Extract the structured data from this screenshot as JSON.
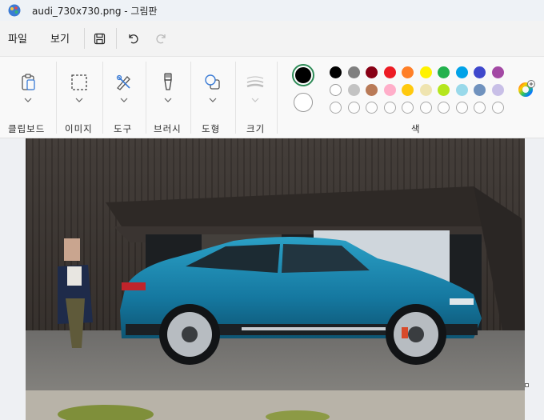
{
  "window": {
    "title": "audi_730x730.png - 그림판"
  },
  "menu": {
    "file": "파일",
    "view": "보기"
  },
  "toolbar": {
    "save_icon": "save-icon",
    "undo_icon": "undo-icon",
    "redo_icon": "redo-icon"
  },
  "ribbon": {
    "groups": [
      {
        "label": "클립보드",
        "icon": "clipboard-icon"
      },
      {
        "label": "이미지",
        "icon": "select-icon"
      },
      {
        "label": "도구",
        "icon": "tools-icon"
      },
      {
        "label": "브러시",
        "icon": "brush-icon"
      },
      {
        "label": "도형",
        "icon": "shapes-icon"
      },
      {
        "label": "크기",
        "icon": "size-icon"
      }
    ],
    "colors_label": "색",
    "primary_color": "#000000",
    "secondary_color": "#ffffff",
    "palette_row1": [
      "#000000",
      "#7f7f7f",
      "#880015",
      "#ed1c24",
      "#ff7f27",
      "#fff200",
      "#22b14c",
      "#00a2e8",
      "#3f48cc",
      "#a349a4"
    ],
    "palette_row2": [
      "#ffffff",
      "#c3c3c3",
      "#b97a57",
      "#ffaec9",
      "#ffc90e",
      "#efe4b0",
      "#b5e61d",
      "#99d9ea",
      "#7092be",
      "#c8bfe7"
    ],
    "edit_colors_icon": "color-wheel-icon"
  },
  "canvas": {
    "image": "audi-photo"
  }
}
